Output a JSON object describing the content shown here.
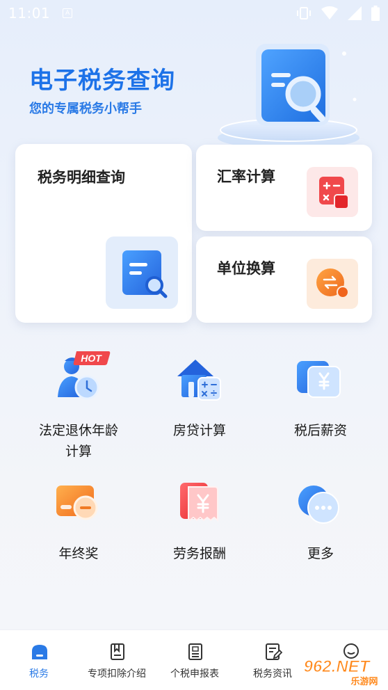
{
  "status_bar": {
    "time": "11:01",
    "notification_icon": "a-badge-icon",
    "right_icons": [
      "vibrate-icon",
      "wifi-icon",
      "signal-icon",
      "battery-icon"
    ]
  },
  "hero": {
    "title": "电子税务查询",
    "subtitle": "您的专属税务小帮手",
    "illustration": "document-search-icon"
  },
  "cards": {
    "detail_query": {
      "title": "税务明细查询",
      "icon": "document-search-icon"
    },
    "exchange_rate": {
      "title": "汇率计算",
      "icon": "calculator-icon"
    },
    "unit_convert": {
      "title": "单位换算",
      "icon": "exchange-icon"
    }
  },
  "grid": [
    {
      "label_line1": "法定退休年龄",
      "label_line2": "计算",
      "icon": "retirement-clock-icon",
      "badge": "HOT"
    },
    {
      "label_line1": "房贷计算",
      "icon": "house-calculator-icon"
    },
    {
      "label_line1": "税后薪资",
      "icon": "yuan-card-icon"
    },
    {
      "label_line1": "年终奖",
      "icon": "bonus-card-icon"
    },
    {
      "label_line1": "劳务报酬",
      "icon": "yuan-receipt-icon"
    },
    {
      "label_line1": "更多",
      "icon": "more-dots-icon"
    }
  ],
  "bottom_nav": [
    {
      "label": "税务",
      "icon": "home-icon",
      "active": true
    },
    {
      "label": "专项扣除介绍",
      "icon": "bookmark-doc-icon",
      "active": false
    },
    {
      "label": "个税申报表",
      "icon": "tax-form-icon",
      "active": false
    },
    {
      "label": "税务资讯",
      "icon": "edit-doc-icon",
      "active": false
    },
    {
      "label": "",
      "icon": "chat-icon",
      "active": false
    }
  ],
  "watermark": {
    "text": "962.NET",
    "subtext": "乐游网"
  },
  "colors": {
    "primary": "#2a7ae6",
    "title_blue": "#1d72e8",
    "accent_red": "#f0484b",
    "accent_orange": "#f68a2e"
  }
}
